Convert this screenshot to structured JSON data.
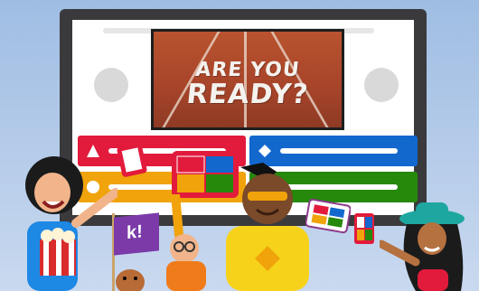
{
  "quiz_image": {
    "line1": "ARE YOU",
    "line2": "READY?"
  },
  "flag": {
    "label": "k!"
  },
  "colors": {
    "monitor": "#3a3a3d",
    "red": "#e21b3c",
    "blue": "#1368ce",
    "yellow": "#f0a30a",
    "green": "#26890c",
    "brand_purple": "#7b3aa8"
  }
}
